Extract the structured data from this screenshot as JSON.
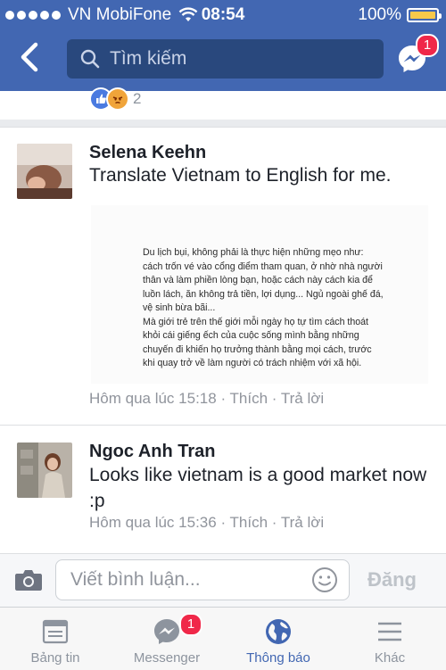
{
  "status": {
    "carrier": "VN MobiFone",
    "time": "08:54",
    "battery": "100%"
  },
  "header": {
    "search_placeholder": "Tìm kiếm",
    "messenger_badge": "1"
  },
  "prev_post": {
    "reaction_count": "2"
  },
  "comments": [
    {
      "name": "Selena Keehn",
      "text": "Translate Vietnam to English for me.",
      "attachment_lines": [
        "Du lịch bụi, không phải là thực hiện những mẹo như:",
        "cách trốn vé vào cổng điểm tham quan, ở nhờ nhà người",
        "thân và làm phiền lòng bạn, hoặc cách này cách kia để",
        "luồn lách, ăn không trả tiền, lợi dụng... Ngủ ngoài ghế đá,",
        "vệ sinh bừa bãi...",
        "Mà giới trẻ trên thế giới mỗi ngày họ tự tìm cách thoát",
        "khỏi cái giếng ếch của cuộc sống mình bằng những",
        "chuyến đi khiến họ trưởng thành bằng mọi cách, trước",
        "khi quay trở về làm người có trách nhiệm với xã hội."
      ],
      "time": "Hôm qua lúc 15:18",
      "like": "Thích",
      "reply": "Trả lời",
      "dot": "·"
    },
    {
      "name": "Ngoc Anh Tran",
      "text": "Looks like vietnam is a good market now :p",
      "time": "Hôm qua lúc 15:36",
      "like": "Thích",
      "reply": "Trả lời",
      "dot": "·"
    }
  ],
  "composer": {
    "placeholder": "Viết bình luận...",
    "post_label": "Đăng"
  },
  "tabs": [
    {
      "label": "Bảng tin",
      "icon": "news-feed-icon"
    },
    {
      "label": "Messenger",
      "icon": "messenger-icon",
      "badge": "1"
    },
    {
      "label": "Thông báo",
      "icon": "globe-icon",
      "active": true
    },
    {
      "label": "Khác",
      "icon": "menu-icon"
    }
  ],
  "colors": {
    "brand": "#4267b2",
    "badge": "#f02849",
    "link_active": "#4267b2"
  }
}
